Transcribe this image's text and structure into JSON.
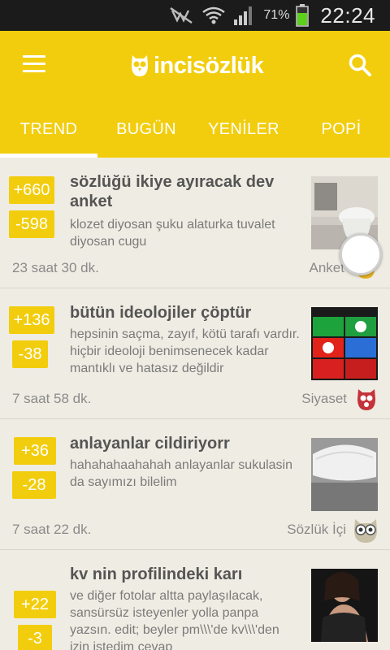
{
  "status_bar": {
    "battery": "71%",
    "time": "22:24"
  },
  "app": {
    "logo_text": "incisözlük",
    "brand_color": "#f2cd0d",
    "menu_icon": "hamburger-menu-icon",
    "search_icon": "search-icon"
  },
  "tabs": [
    {
      "label": "TREND",
      "active": true
    },
    {
      "label": "BUGÜN",
      "active": false
    },
    {
      "label": "YENİLER",
      "active": false
    },
    {
      "label": "POPİ",
      "active": false
    }
  ],
  "posts": [
    {
      "upvotes": "+660",
      "downvotes": "-598",
      "title": "sözlüğü ikiye ayıracak dev anket",
      "body": "klozet diyosan şuku alaturka tuvalet diyosan cugu",
      "time": "23 saat 30 dk.",
      "category": "Anket"
    },
    {
      "upvotes": "+136",
      "downvotes": "-38",
      "title": "bütün ideolojiler çöptür",
      "body": "hepsinin saçma, zayıf, kötü tarafı vardır. hiçbir ideoloji benimsenecek kadar mantıklı ve hatasız değildir",
      "time": "7 saat 58 dk.",
      "category": "Siyaset"
    },
    {
      "upvotes": "+36",
      "downvotes": "-28",
      "title": "anlayanlar cildiriyorr",
      "body": "hahahahaahahah anlayanlar sukulasin da sayımızı bilelim",
      "time": "7 saat 22 dk.",
      "category": "Sözlük İçi"
    },
    {
      "upvotes": "+22",
      "downvotes": "-3",
      "title": "kv nin profilindeki karı",
      "body": "ve diğer fotolar altta paylaşılacak, sansürsüz isteyenler yolla panpa yazsın. edit; beyler pm\\\\\\'de kv\\\\\\'den izin istedim cevap",
      "time": "",
      "category": ""
    }
  ]
}
